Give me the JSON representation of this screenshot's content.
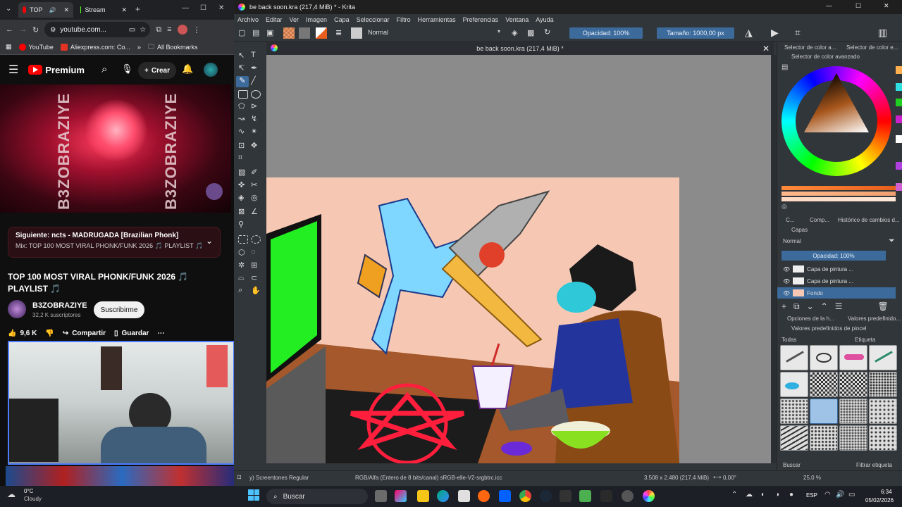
{
  "chrome": {
    "tabs": [
      {
        "label": "TOP",
        "color": "#ff0000"
      },
      {
        "label": "Stream",
        "color": "#53fc18"
      }
    ],
    "url": "youtube.com...",
    "bookmarks": [
      "YouTube",
      "Aliexpress.com: Co...",
      "All Bookmarks"
    ]
  },
  "youtube": {
    "brand": "Premium",
    "create_label": "Crear",
    "thumb_text_left": "B3ZOBRAZIYE",
    "thumb_text_right": "B3ZOBRAZIYE",
    "next_label": "Siguiente: ncts - MADRUGADA [Brazilian Phonk]",
    "next_mix": "Mix: TOP 100 MOST VIRAL PHONK/FUNK 2026 🎵 PLAYLIST 🎵",
    "title": "TOP 100 MOST VIRAL PHONK/FUNK 2026 🎵 PLAYLIST 🎵",
    "channel_name": "B3ZOBRAZIYE",
    "subscribers": "32,2 K suscriptores",
    "subscribe_label": "Suscribirme",
    "likes": "9,6 K",
    "share_label": "Compartir",
    "save_label": "Guardar"
  },
  "krita": {
    "window_title": "be back soon.kra (217,4 MiB) * - Krita",
    "menu": [
      "Archivo",
      "Editar",
      "Ver",
      "Imagen",
      "Capa",
      "Seleccionar",
      "Filtro",
      "Herramientas",
      "Preferencias",
      "Ventana",
      "Ayuda"
    ],
    "blend_mode": "Normal",
    "opacity": "Opacidad: 100%",
    "size": "Tamaño: 1000,00 px",
    "doc_tab": "be back soon.kra (217,4 MiB) *",
    "docker_tabs": [
      "Selector de color a...",
      "Selector de color e..."
    ],
    "color_selector_title": "Selector de color avanzado",
    "layers_tabs": [
      "C...",
      "Comp...",
      "Histórico de cambios d..."
    ],
    "layers_title": "Capas",
    "layer_blend": "Normal",
    "layer_opacity": "Opacidad: 100%",
    "layers": [
      "Capa de pintura ...",
      "Capa de pintura ...",
      "Fondo"
    ],
    "presets_tabs": [
      "Opciones de la h...",
      "Valores predefinido..."
    ],
    "presets_title": "Valores predefinidos de pincel",
    "presets_filter": "Todas",
    "presets_tag": "Etiqueta",
    "presets_search": "Buscar",
    "presets_filter_tag": "Filtrar etiqueta",
    "status_font": "y) Screentones Regular",
    "status_color": "RGB/Alfa (Entero de 8 bits/canal)  sRGB-elle-V2-srgbtrc.icc",
    "status_dims": "3.508 x 2.480 (217,4 MiB)",
    "status_rotation": "0,00°",
    "status_zoom": "25,0 %"
  },
  "taskbar": {
    "weather_temp": "0°C",
    "weather_desc": "Cloudy",
    "search": "Buscar",
    "lang": "ESP",
    "time": "6:34",
    "date": "05/02/2026"
  }
}
